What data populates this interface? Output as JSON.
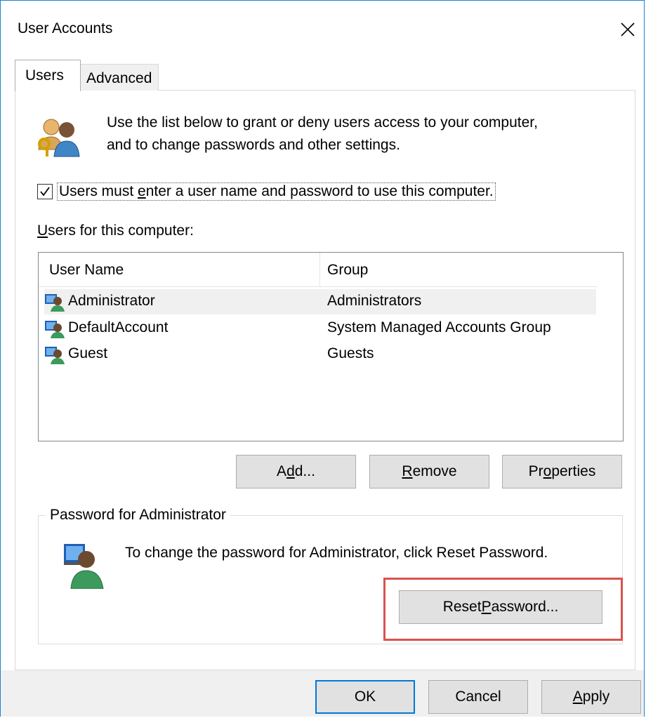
{
  "window": {
    "title": "User Accounts",
    "close_symbol": "×"
  },
  "tabs": [
    {
      "label": "Users",
      "selected": true
    },
    {
      "label": "Advanced",
      "selected": false
    }
  ],
  "intro": {
    "line1": "Use the list below to grant or deny users access to your computer,",
    "line2": "and to change passwords and other settings."
  },
  "login_checkbox": {
    "checked": true,
    "label_pre": "Users must ",
    "label_mnemonic": "e",
    "label_post": "nter a user name and password to use this computer."
  },
  "users_section": {
    "label_mnemonic": "U",
    "label_rest": "sers for this computer:"
  },
  "list": {
    "columns": [
      "User Name",
      "Group"
    ],
    "rows": [
      {
        "name": "Administrator",
        "group": "Administrators",
        "selected": true
      },
      {
        "name": "DefaultAccount",
        "group": "System Managed Accounts Group",
        "selected": false
      },
      {
        "name": "Guest",
        "group": "Guests",
        "selected": false
      }
    ]
  },
  "list_buttons": {
    "add": {
      "pre": "A",
      "mnemonic": "d",
      "post": "d..."
    },
    "remove": {
      "pre": "",
      "mnemonic": "R",
      "post": "emove"
    },
    "properties": {
      "pre": "Pr",
      "mnemonic": "o",
      "post": "perties"
    }
  },
  "password_group": {
    "title": "Password for Administrator",
    "text": "To change the password for Administrator, click Reset Password.",
    "reset_button": {
      "pre": "Reset ",
      "mnemonic": "P",
      "post": "assword..."
    }
  },
  "dialog_buttons": {
    "ok": "OK",
    "cancel": "Cancel",
    "apply": {
      "pre": "",
      "mnemonic": "A",
      "post": "pply"
    }
  },
  "colors": {
    "window_border": "#1883d7",
    "default_button_border": "#0078d7",
    "highlight_box": "#d9534f",
    "selected_row": "#f0f0f0"
  },
  "icons": {
    "close": "close-icon",
    "users_header": "users-keys-icon",
    "user_row": "user-icon",
    "admin": "administrator-user-icon",
    "checkmark": "checkmark-icon"
  }
}
